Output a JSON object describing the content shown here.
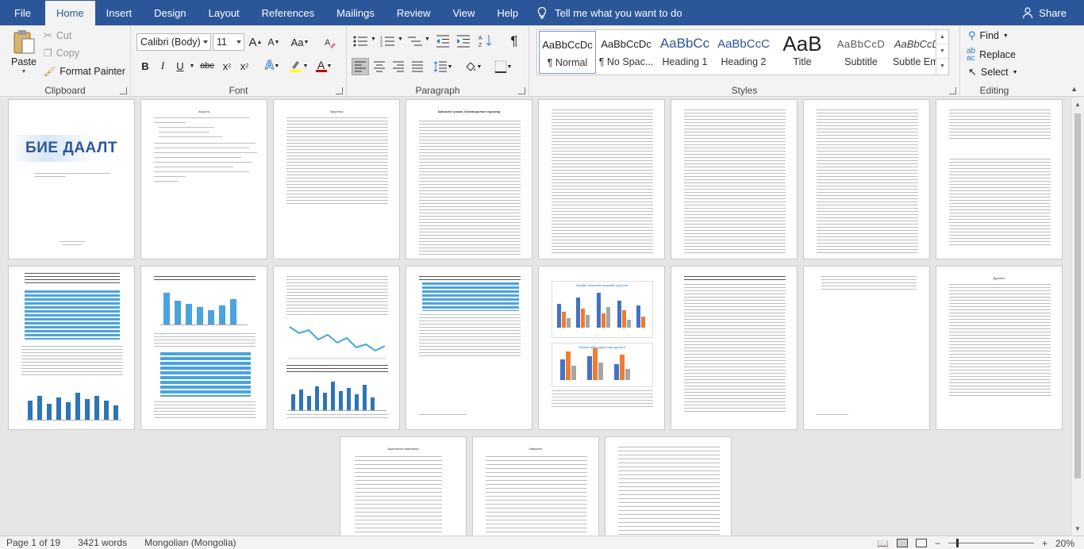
{
  "tabs": [
    {
      "label": "File"
    },
    {
      "label": "Home"
    },
    {
      "label": "Insert"
    },
    {
      "label": "Design"
    },
    {
      "label": "Layout"
    },
    {
      "label": "References"
    },
    {
      "label": "Mailings"
    },
    {
      "label": "Review"
    },
    {
      "label": "View"
    },
    {
      "label": "Help"
    }
  ],
  "tell_me": "Tell me what you want to do",
  "share": "Share",
  "clipboard": {
    "label": "Clipboard",
    "paste": "Paste",
    "cut": "Cut",
    "copy": "Copy",
    "format_painter": "Format Painter"
  },
  "font": {
    "label": "Font",
    "family": "Calibri (Body)",
    "size": "11",
    "grow": "A",
    "shrink": "A",
    "change_case": "Aa",
    "bold": "B",
    "italic": "I",
    "underline": "U",
    "strike": "abc",
    "subscript": "x",
    "superscript": "x",
    "font_color_glyph": "A",
    "text_effects_glyph": "A",
    "font_color": "#c00000",
    "highlight_color": "#ffff00"
  },
  "paragraph": {
    "label": "Paragraph",
    "show_marks": "¶"
  },
  "styles": {
    "label": "Styles",
    "items": [
      {
        "sample": "AaBbCcDc",
        "name": "¶ Normal"
      },
      {
        "sample": "AaBbCcDc",
        "name": "¶ No Spac..."
      },
      {
        "sample": "AaBbCc",
        "name": "Heading 1"
      },
      {
        "sample": "AaBbCcC",
        "name": "Heading 2"
      },
      {
        "sample": "AaB",
        "name": "Title"
      },
      {
        "sample": "AaBbCcD",
        "name": "Subtitle"
      },
      {
        "sample": "AaBbCcDa",
        "name": "Subtle Em..."
      }
    ]
  },
  "editing": {
    "label": "Editing",
    "find": "Find",
    "replace": "Replace",
    "select": "Select"
  },
  "document": {
    "cover_title": "БИЕ ДААЛТ",
    "page_headings": {
      "p2": "Агуулга",
      "p3": "Удиртгал",
      "p4": "Шинжлэх ухаан, боловсролын хүрээнд",
      "p12": "Дүгнэлт",
      "p17": "Ашигласан материал",
      "p18": "Хавсралт"
    },
    "chart_caption_1": "Бүсийн хөгжлийн ерөнхий үзүүлэлт",
    "chart_caption_2": "Бүсийн аймгуудын харьцуулалт",
    "accent_color": "#2b579a",
    "chart_color": "#4aa3df"
  },
  "status": {
    "page": "Page 1 of 19",
    "words": "3421 words",
    "language": "Mongolian (Mongolia)",
    "zoom": "20%"
  }
}
